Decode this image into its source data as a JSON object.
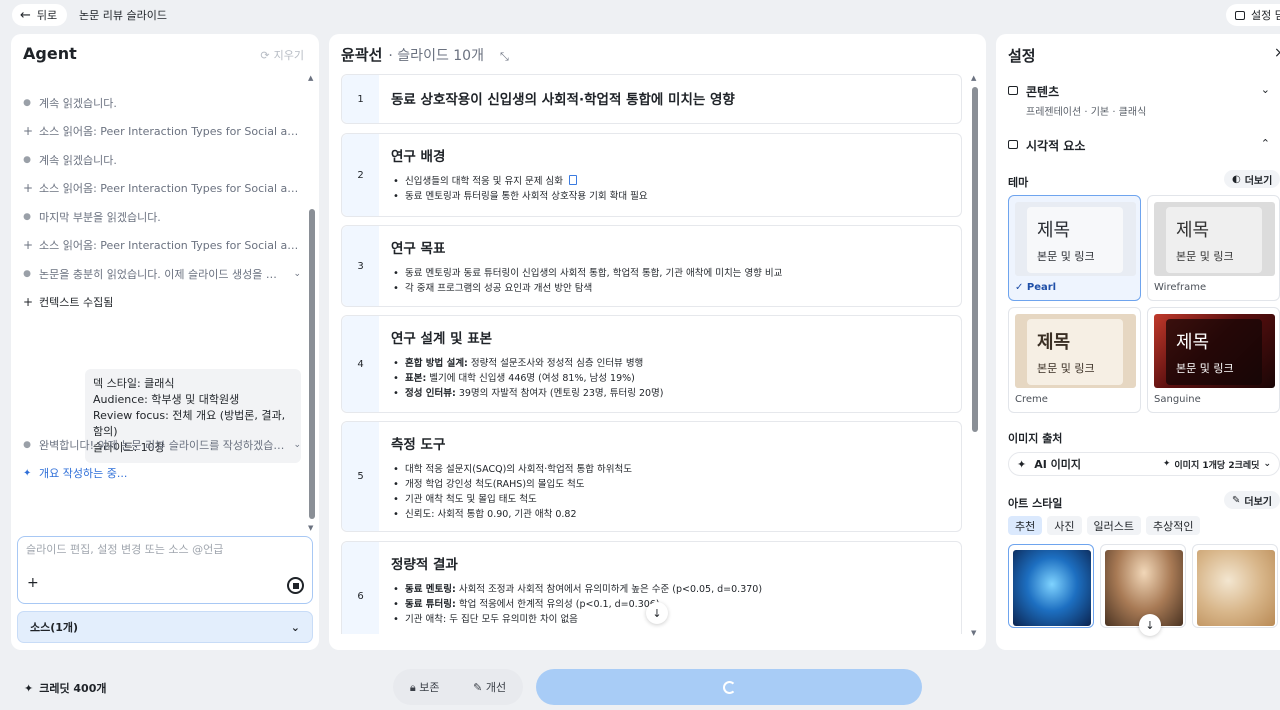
{
  "topbar": {
    "back_label": "뒤로",
    "doc_title": "논문 리뷰 슬라이드",
    "settings_toggle_label": "설정 닫기"
  },
  "agent": {
    "title": "Agent",
    "clear_label": "지우기",
    "log": [
      {
        "icon": "dot",
        "text": "계속 읽겠습니다."
      },
      {
        "icon": "plus",
        "text": "소스 읽어옴: Peer Interaction Types for Social and ..."
      },
      {
        "icon": "dot",
        "text": "계속 읽겠습니다."
      },
      {
        "icon": "plus",
        "text": "소스 읽어옴: Peer Interaction Types for Social and ..."
      },
      {
        "icon": "dot",
        "text": "마지막 부분을 읽겠습니다."
      },
      {
        "icon": "plus",
        "text": "소스 읽어옴: Peer Interaction Types for Social and ..."
      },
      {
        "icon": "dot",
        "text": "논문을 충분히 읽었습니다. 이제 슬라이드 생성을 위한..."
      },
      {
        "icon": "plus",
        "text": "컨텍스트 수집됨"
      }
    ],
    "context_lines": [
      "덱 스타일: 클래식",
      "Audience: 학부생 및 대학원생",
      "Review focus: 전체 개요 (방법론, 결과, 함의)",
      "슬라이드: 10장"
    ],
    "after_log": [
      {
        "icon": "dot",
        "text": "완벽합니다! 이제 논문 리뷰 슬라이드를 작성하겠습니..."
      },
      {
        "icon": "sparkle",
        "text": "개요 작성하는 중..."
      }
    ],
    "input_placeholder": "슬라이드 편집, 설정 변경 또는 소스 @언급",
    "sources_label": "소스(1개)"
  },
  "outline": {
    "title": "윤곽선",
    "subtitle": "· 슬라이드 10개",
    "slides": [
      {
        "num": "1",
        "title": "동료 상호작용이 신입생의 사회적·학업적 통합에 미치는 영향",
        "bullets": []
      },
      {
        "num": "2",
        "title": "연구 배경",
        "bullets": [
          {
            "bold": "",
            "text": "신입생들의 대학 적응 및 유지 문제 심화"
          },
          {
            "bold": "",
            "text": "동료 멘토링과 튜터링을 통한 사회적 상호작용 기회 확대 필요"
          }
        ]
      },
      {
        "num": "3",
        "title": "연구 목표",
        "bullets": [
          {
            "bold": "",
            "text": "동료 멘토링과 동료 튜터링이 신입생의 사회적 통합, 학업적 통합, 기관 애착에 미치는 영향 비교"
          },
          {
            "bold": "",
            "text": "각 중재 프로그램의 성공 요인과 개선 방안 탐색"
          }
        ]
      },
      {
        "num": "4",
        "title": "연구 설계 및 표본",
        "bullets": [
          {
            "bold": "혼합 방법 설계:",
            "text": " 정량적 설문조사와 정성적 심층 인터뷰 병행"
          },
          {
            "bold": "표본:",
            "text": " 벨기에 대학 신입생 446명 (여성 81%, 남성 19%)"
          },
          {
            "bold": "정성 인터뷰:",
            "text": " 39명의 자발적 참여자 (멘토링 23명, 튜터링 20명)"
          }
        ]
      },
      {
        "num": "5",
        "title": "측정 도구",
        "bullets": [
          {
            "bold": "",
            "text": "대학 적응 설문지(SACQ)의 사회적·학업적 통합 하위척도"
          },
          {
            "bold": "",
            "text": "개정 학업 강인성 척도(RAHS)의 몰입도 척도"
          },
          {
            "bold": "",
            "text": "기관 애착 척도 및 몰입 태도 척도"
          },
          {
            "bold": "",
            "text": "신뢰도: 사회적 통합 0.90, 기관 애착 0.82"
          }
        ]
      },
      {
        "num": "6",
        "title": "정량적 결과",
        "bullets": [
          {
            "bold": "동료 멘토링:",
            "text": " 사회적 조정과 사회적 참여에서 유의미하게 높은 수준 (p<0.05, d=0.370)"
          },
          {
            "bold": "동료 튜터링:",
            "text": " 학업 적응에서 한계적 유의성 (p<0.1, d=0.306)"
          },
          {
            "bold": "",
            "text": "기관 애착: 두 집단 모두 유의미한 차이 없음"
          }
        ]
      }
    ]
  },
  "settings": {
    "title": "설정",
    "content": {
      "label": "콘텐츠",
      "sub": "프레젠테이션 · 기본 · 클래식"
    },
    "visual": {
      "label": "시각적 요소"
    },
    "theme_label": "테마",
    "more_label": "더보기",
    "themes": [
      {
        "name": "Pearl",
        "heading": "제목",
        "body": "본문 및 링크",
        "selected": true
      },
      {
        "name": "Wireframe",
        "heading": "제목",
        "body": "본문 및 링크",
        "selected": false
      },
      {
        "name": "Creme",
        "heading": "제목",
        "body": "본문 및 링크",
        "selected": false
      },
      {
        "name": "Sanguine",
        "heading": "제목",
        "body": "본문 및 링크",
        "selected": false
      }
    ],
    "image_source_label": "이미지 출처",
    "image_source_value": "AI 이미지",
    "image_cost": "이미지 1개당 2크레딧",
    "art_style_label": "아트 스타일",
    "art_more_label": "더보기",
    "art_tabs": [
      "추천",
      "사진",
      "일러스트",
      "추상적인"
    ],
    "art_tab_active": "추천"
  },
  "bottom": {
    "credits": "크레딧 400개",
    "keep_label": "보존",
    "improve_label": "개선"
  },
  "colors": {
    "accent": "#2f6fd8",
    "generate_button": "#a8ccf6",
    "panel_bg": "#ffffff",
    "page_bg": "#eef0f3"
  }
}
